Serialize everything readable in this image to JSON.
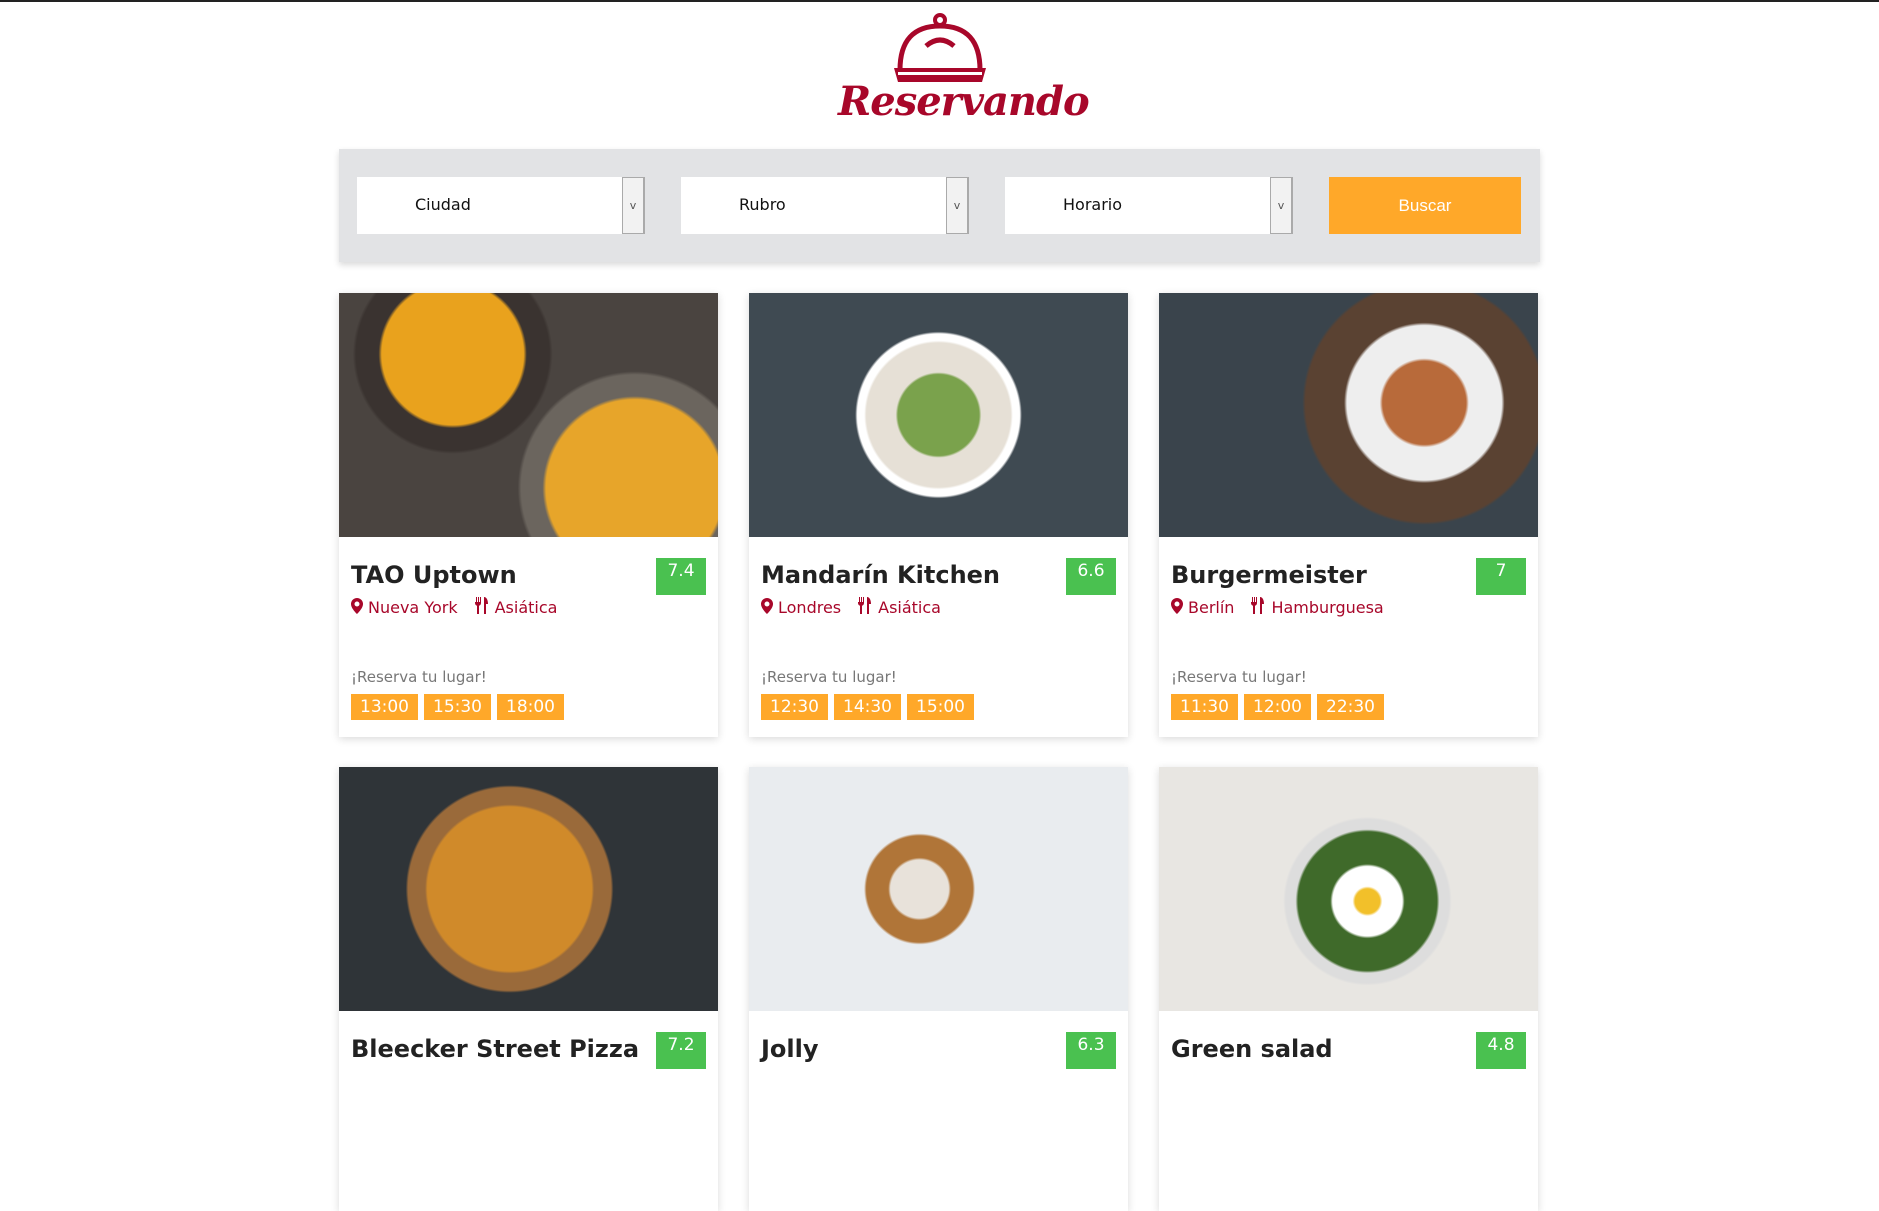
{
  "brand": {
    "name": "Reservando",
    "color": "#a8072a"
  },
  "search": {
    "city": "Ciudad",
    "category": "Rubro",
    "time": "Horario",
    "button": "Buscar",
    "accent": "#ffa829"
  },
  "reserve_label": "¡Reserva tu lugar!",
  "restaurants": [
    {
      "name": "TAO Uptown",
      "score": "7.4",
      "city": "Nueva York",
      "category": "Asiática",
      "times": [
        "13:00",
        "15:30",
        "18:00"
      ]
    },
    {
      "name": "Mandarín Kitchen",
      "score": "6.6",
      "city": "Londres",
      "category": "Asiática",
      "times": [
        "12:30",
        "14:30",
        "15:00"
      ]
    },
    {
      "name": "Burgermeister",
      "score": "7",
      "city": "Berlín",
      "category": "Hamburguesa",
      "times": [
        "11:30",
        "12:00",
        "22:30"
      ]
    },
    {
      "name": "Bleecker Street Pizza",
      "score": "7.2"
    },
    {
      "name": "Jolly",
      "score": "6.3"
    },
    {
      "name": "Green salad",
      "score": "4.8"
    }
  ]
}
